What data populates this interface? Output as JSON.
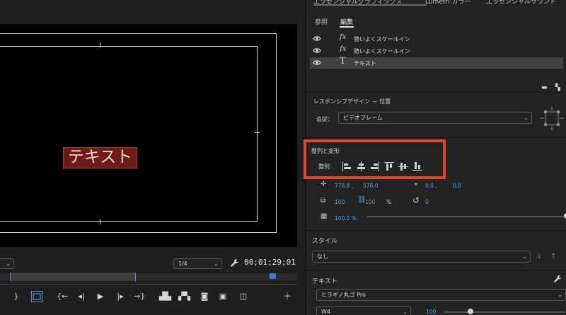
{
  "monitor": {
    "title_text": "テキスト",
    "zoom_label": "",
    "resolution_label": "1/4",
    "timecode": "00;01;29;01"
  },
  "transport": {
    "icons": [
      "mark-out-icon",
      "export-frame-box-icon",
      "go-to-in-icon",
      "step-back-icon",
      "play-icon",
      "step-forward-icon",
      "go-to-out-icon",
      "lift-icon",
      "extract-icon",
      "camera-icon",
      "compare-icon",
      "overlay-icon",
      "add-button-icon"
    ]
  },
  "egp": {
    "header": {
      "tab1": "エッセンシャルグラフィックス",
      "tab2": "Lumetri カラー",
      "tab3": "エッセンシャルサウンド"
    },
    "subtabs": {
      "browse": "参照",
      "edit": "編集"
    },
    "layers": [
      {
        "icon": "fx",
        "name": "勢いよくスケールイン",
        "selected": false
      },
      {
        "icon": "fx",
        "name": "勢いよくスケールイン",
        "selected": false
      },
      {
        "icon": "T",
        "name": "テキスト",
        "selected": true
      }
    ],
    "responsive": {
      "title": "レスポンシブデザイン — 位置",
      "follow_label": "追従：",
      "follow_value": "ビデオフレーム"
    },
    "align": {
      "title": "整列と変形",
      "label": "整列"
    },
    "transform": {
      "pos_x": "778.8 ,",
      "pos_y": "578.0",
      "anchor_x": "0.0 ,",
      "anchor_y": "0.0",
      "scale": "100",
      "scale_h": "100",
      "scale_unit": "%",
      "rotation": "0",
      "opacity": "100.0 %",
      "opacity_level": 1.0
    },
    "style": {
      "title": "スタイル",
      "value": "なし"
    },
    "text": {
      "title": "テキスト",
      "font": "ヒラギノ丸ゴ Pro",
      "weight": "W4",
      "size": "100"
    }
  },
  "colors": {
    "highlight_box": "#e5442d",
    "accent_blue": "#5b9ded",
    "title_bg": "#6e1c18"
  }
}
